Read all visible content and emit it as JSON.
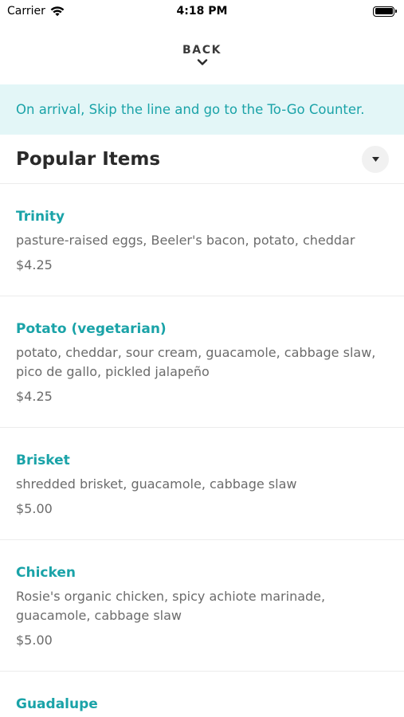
{
  "status_bar": {
    "carrier": "Carrier",
    "time": "4:18 PM"
  },
  "header": {
    "back_label": "BACK"
  },
  "banner": {
    "text": "On arrival, Skip the line and go to the To-Go Counter."
  },
  "section": {
    "title": "Popular Items"
  },
  "items": [
    {
      "name": "Trinity",
      "description": "pasture-raised eggs, Beeler's bacon, potato, cheddar",
      "price": "$4.25"
    },
    {
      "name": "Potato (vegetarian)",
      "description": "potato, cheddar, sour cream, guacamole, cabbage slaw, pico de gallo, pickled jalapeño",
      "price": "$4.25"
    },
    {
      "name": "Brisket",
      "description": "shredded brisket, guacamole, cabbage slaw",
      "price": "$5.00"
    },
    {
      "name": "Chicken",
      "description": "Rosie's organic chicken, spicy achiote marinade, guacamole, cabbage slaw",
      "price": "$5.00"
    },
    {
      "name": "Guadalupe",
      "description": "",
      "price": ""
    }
  ],
  "colors": {
    "accent": "#1aa3a8",
    "banner_bg": "#e3f6f7",
    "divider": "#ececec",
    "muted_text": "#6b6b6b"
  }
}
